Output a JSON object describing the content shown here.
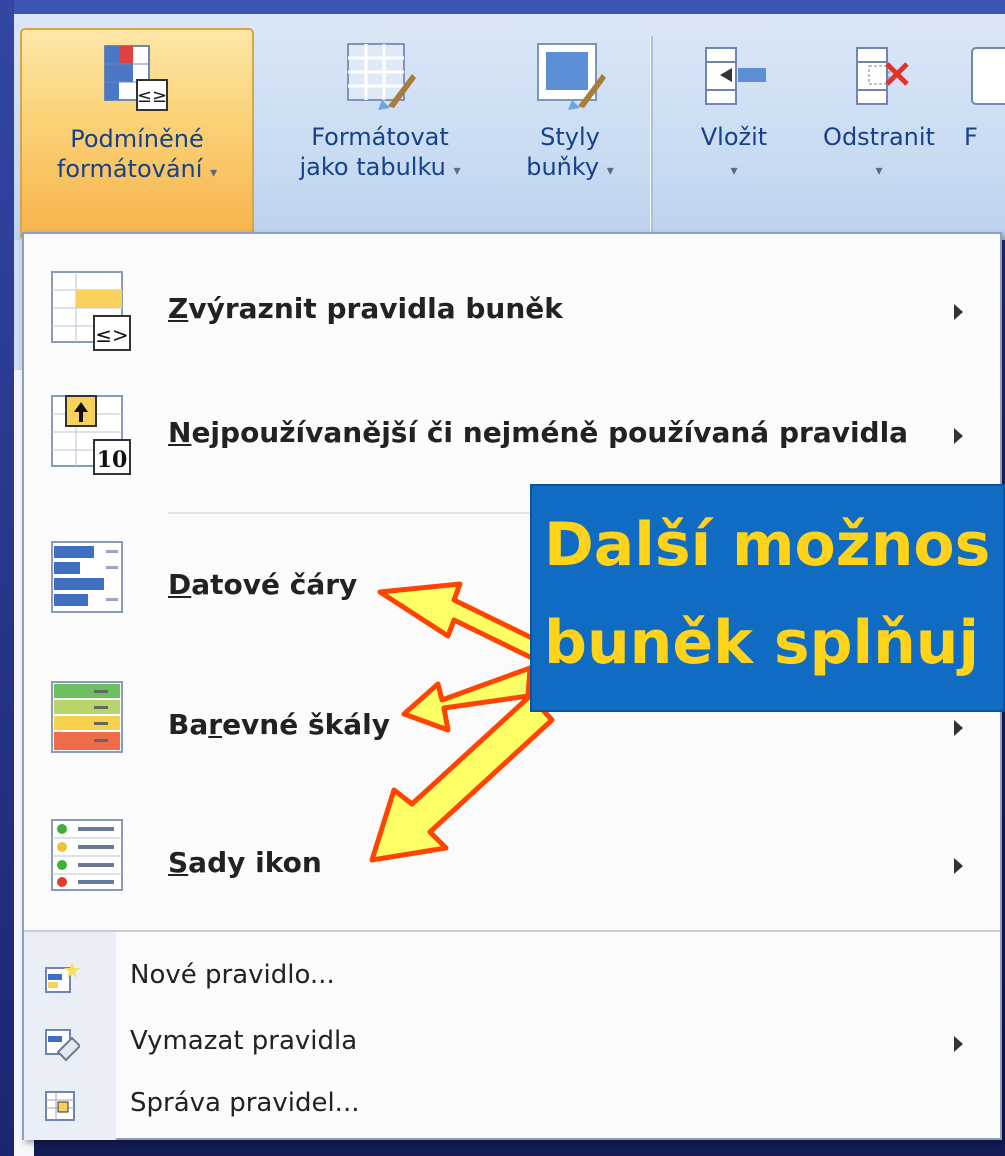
{
  "ribbon": {
    "buttons": [
      {
        "line1": "Podmíněné",
        "line2": "formátování",
        "active": true
      },
      {
        "line1": "Formátovat",
        "line2": "jako tabulku"
      },
      {
        "line1": "Styly",
        "line2": "buňky"
      },
      {
        "line1": "Vložit",
        "line2": ""
      },
      {
        "line1": "Odstranit",
        "line2": ""
      },
      {
        "line1": "F",
        "line2": ""
      }
    ]
  },
  "menu": {
    "items": [
      {
        "label": "Zvýraznit pravidla buněk",
        "accel": "Z",
        "submenu": true,
        "icon": "highlight-cell-rules-icon"
      },
      {
        "label": "Nejpoužívanější či nejméně používaná pravidla",
        "accel": "N",
        "submenu": true,
        "icon": "top-bottom-rules-icon"
      },
      {
        "label": "Datové čáry",
        "accel": "D",
        "submenu": true,
        "icon": "data-bars-icon"
      },
      {
        "label": "Barevné škály",
        "accel": "r",
        "submenu": true,
        "icon": "color-scales-icon"
      },
      {
        "label": "Sady ikon",
        "accel": "S",
        "submenu": true,
        "icon": "icon-sets-icon"
      }
    ],
    "small_items": [
      {
        "label": "Nové pravidlo...",
        "submenu": false,
        "icon": "new-rule-icon"
      },
      {
        "label": "Vymazat pravidla",
        "submenu": true,
        "icon": "clear-rules-icon"
      },
      {
        "label": "Správa pravidel...",
        "submenu": false,
        "icon": "manage-rules-icon"
      }
    ]
  },
  "callout": {
    "line1": "Další možnos",
    "line2": "buněk splňuj"
  },
  "colors": {
    "callout_bg": "#0f6cc2",
    "callout_text": "#ffd31a",
    "arrow_fill": "#ffff66",
    "arrow_stroke": "#ff4400",
    "ribbon_text": "#15428b"
  }
}
